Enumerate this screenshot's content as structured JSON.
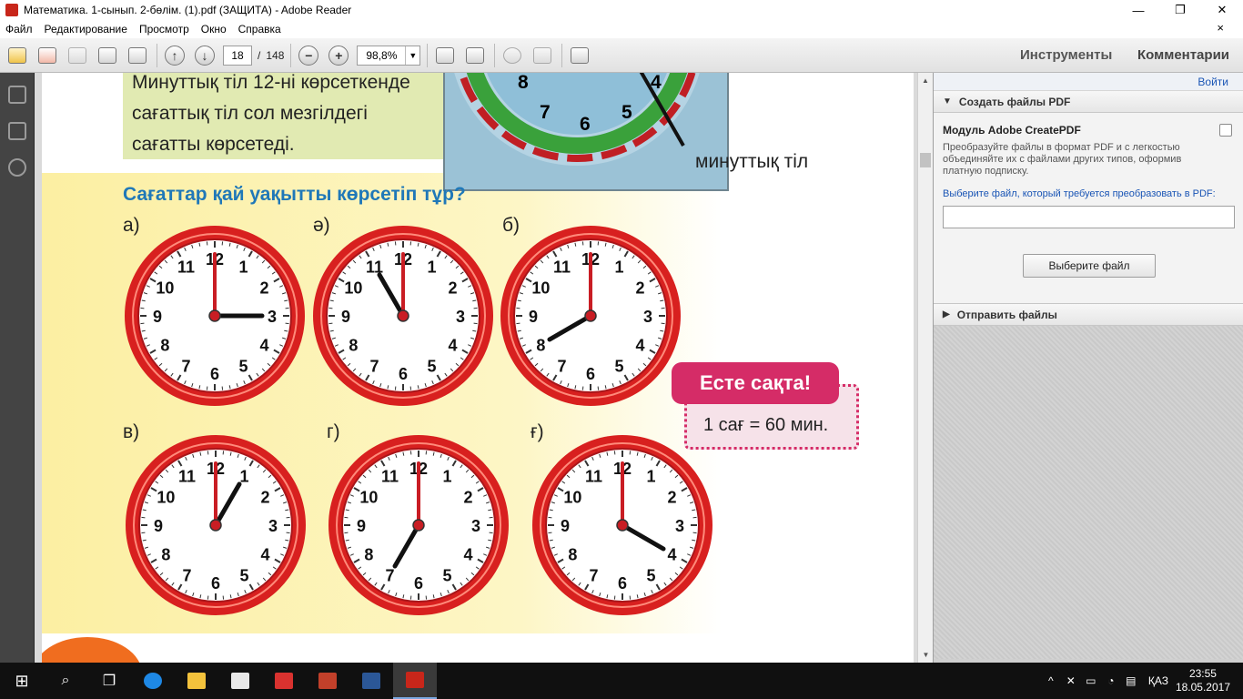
{
  "window": {
    "title": "Математика. 1-сынып. 2-бөлім. (1).pdf (ЗАЩИТА) - Adobe Reader",
    "min": "—",
    "max": "❐",
    "close": "✕"
  },
  "menu": [
    "Файл",
    "Редактирование",
    "Просмотр",
    "Окно",
    "Справка"
  ],
  "menu_close": "×",
  "toolbar": {
    "page": "18",
    "page_sep": "/",
    "page_total": "148",
    "zoom": "98,8%",
    "tools": "Инструменты",
    "comments": "Комментарии"
  },
  "doc": {
    "green_lines": [
      "Минуттық тіл 12-ні көрсеткенде",
      "сағаттық тіл сол мезгілдегі",
      "сағатты көрсетеді."
    ],
    "top_clock_numbers": [
      "8",
      "7",
      "6",
      "5",
      "4"
    ],
    "minute_hand_label": "минуттық тіл",
    "heading": "Сағаттар қай уақытты көрсетіп тұр?",
    "clocks": [
      {
        "label": "а)",
        "hour": 3,
        "minute": 0
      },
      {
        "label": "ә)",
        "hour": 11,
        "minute": 0
      },
      {
        "label": "б)",
        "hour": 8,
        "minute": 0
      },
      {
        "label": "в)",
        "hour": 1,
        "minute": 0
      },
      {
        "label": "г)",
        "hour": 7,
        "minute": 0
      },
      {
        "label": "ғ)",
        "hour": 4,
        "minute": 0
      }
    ],
    "clock_numbers": [
      "12",
      "1",
      "2",
      "3",
      "4",
      "5",
      "6",
      "7",
      "8",
      "9",
      "10",
      "11"
    ],
    "remember_title": "Есте сақта!",
    "remember_text": "1 сағ = 60 мин."
  },
  "right_panel": {
    "signin": "Войти",
    "create_pdf": "Создать файлы PDF",
    "module": "Модуль Adobe CreatePDF",
    "description": "Преобразуйте файлы в формат PDF и с легкостью объединяйте их с файлами других типов, оформив платную подписку.",
    "choose_label": "Выберите файл, который требуется преобразовать в PDF:",
    "choose_button": "Выберите файл",
    "send_files": "Отправить файлы"
  },
  "taskbar": {
    "lang": "ҚАЗ",
    "time": "23:55",
    "date": "18.05.2017"
  },
  "colors": {
    "clock_rim": "#d8201f",
    "heading": "#1f78b8",
    "remember": "#d52c67"
  }
}
